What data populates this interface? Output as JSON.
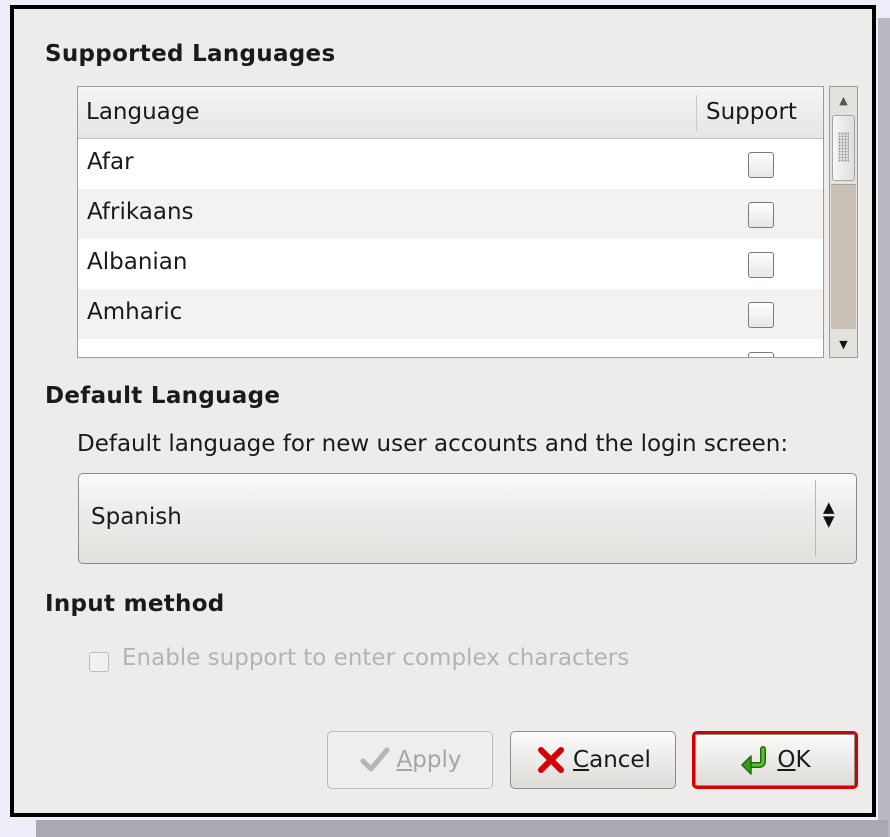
{
  "dialog": {
    "supported_title": "Supported Languages",
    "table": {
      "col_language": "Language",
      "col_support": "Support",
      "rows": [
        {
          "label": "Afar",
          "support": false
        },
        {
          "label": "Afrikaans",
          "support": false
        },
        {
          "label": "Albanian",
          "support": false
        },
        {
          "label": "Amharic",
          "support": false
        }
      ]
    },
    "default_title": "Default Language",
    "default_desc": "Default language for new user accounts and the login screen:",
    "default_value": "Spanish",
    "input_title": "Input method",
    "input_checkbox_label": "Enable support to enter complex characters",
    "buttons": {
      "apply_first": "A",
      "apply_rest": "pply",
      "cancel_first": "C",
      "cancel_rest": "ancel",
      "ok_first": "O",
      "ok_rest": "K"
    },
    "colors": {
      "cancel_icon": "#d40000",
      "ok_icon": "#3a9a19",
      "apply_icon": "#b8b6b3",
      "focus_border": "#d40000"
    },
    "icons": [
      "checkmark-icon",
      "x-icon",
      "enter-arrow-icon",
      "scroll-up-icon",
      "scroll-down-icon",
      "combo-arrows-icon"
    ]
  }
}
